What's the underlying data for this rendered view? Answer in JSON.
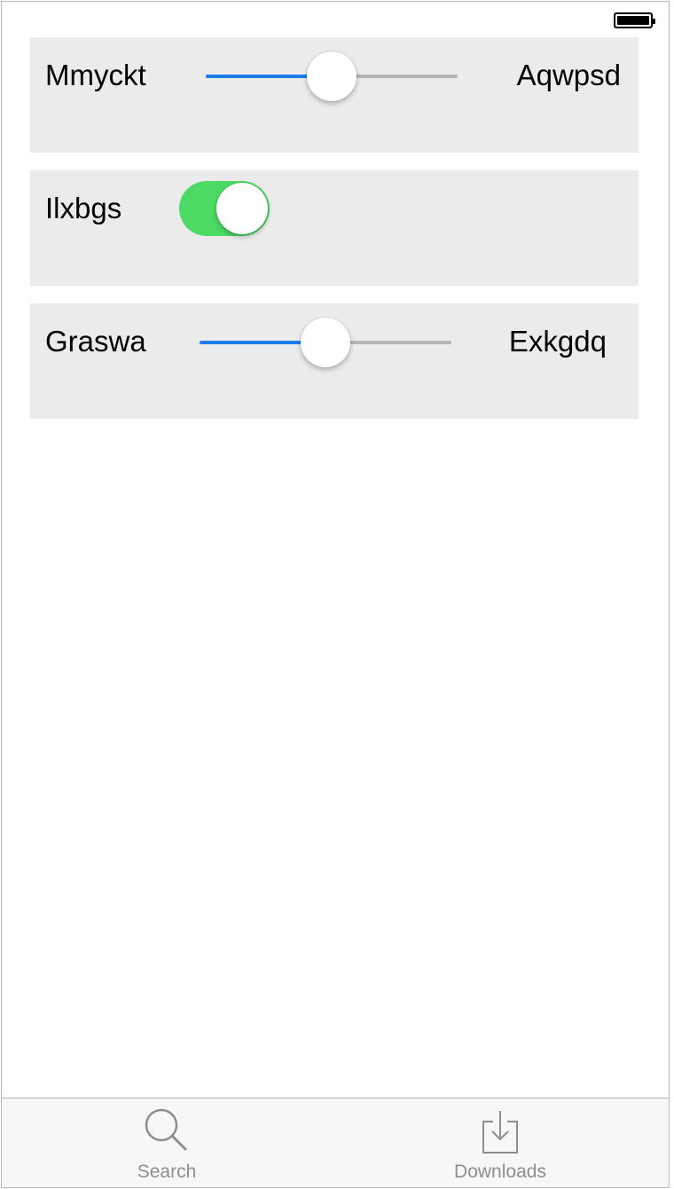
{
  "status_bar": {
    "battery_level": 1.0
  },
  "rows": [
    {
      "type": "slider",
      "label_left": "Mmyckt",
      "label_right": "Aqwpsd",
      "value": 0.5
    },
    {
      "type": "switch",
      "label": "Ilxbgs",
      "on": true
    },
    {
      "type": "slider",
      "label_left": "Graswa",
      "label_right": "Exkgdq",
      "value": 0.5
    }
  ],
  "tabbar": {
    "tabs": [
      {
        "label": "Search",
        "icon": "search-icon"
      },
      {
        "label": "Downloads",
        "icon": "download-icon"
      }
    ]
  },
  "colors": {
    "slider_fill": "#1a7ef0",
    "slider_track": "#b5b5b5",
    "switch_on": "#4cd964",
    "panel_bg": "#ebebeb",
    "tab_inactive": "#8e8e8e"
  }
}
